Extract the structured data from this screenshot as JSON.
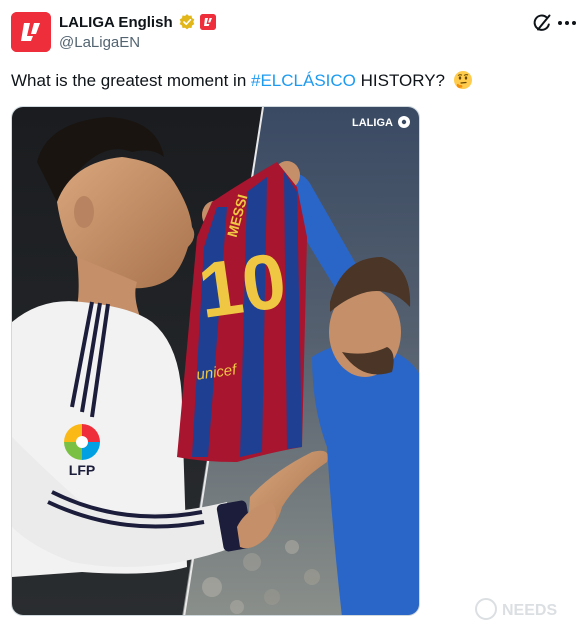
{
  "post": {
    "author": {
      "display_name": "LALIGA English",
      "handle": "@LaLigaEN",
      "verified_badge": "gold-verified-badge-icon",
      "affiliation_badge": "laliga-affiliate-icon"
    },
    "actions": {
      "grok_icon": "grok-icon",
      "more_icon": "more-horizontal-icon"
    },
    "text": {
      "before_hashtag": "What is the greatest moment in ",
      "hashtag": "#ELCLÁSICO",
      "after_hashtag": " HISTORY?",
      "emoji": "thinking-face-emoji"
    },
    "media": {
      "overlay_brand": "LALIGA",
      "left_badge": "LFP",
      "shirt_name": "MESSI",
      "shirt_number": "10",
      "shirt_sponsor": "unicef"
    },
    "watermark_text": "NEEDS"
  },
  "colors": {
    "brand_red": "#ee2e3b",
    "link_blue": "#1d9bf0",
    "secondary_text": "#536471",
    "verified_gold": "#e2b719"
  }
}
